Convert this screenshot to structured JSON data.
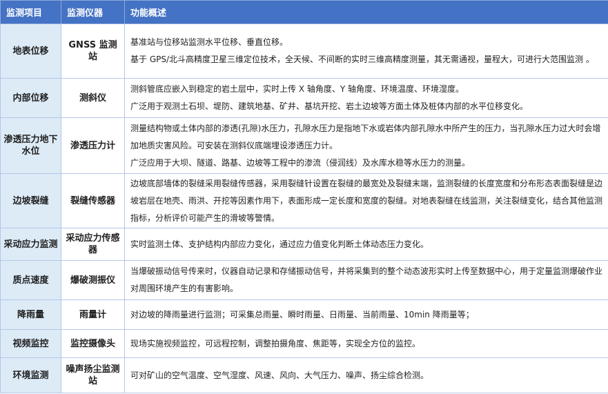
{
  "header": {
    "col1": "监测项目",
    "col2": "监测仪器",
    "col3": "功能概述"
  },
  "rows": [
    {
      "item": "地表位移",
      "instrument": "GNSS 监测站",
      "desc": [
        "基准站与位移站监测水平位移、垂直位移。",
        "基于 GPS/北斗高精度卫星三维定位技术，全天候、不间断的实时三维高精度测量，其无需通视，量程大，可进行大范围监测 。"
      ]
    },
    {
      "item": "内部位移",
      "instrument": "测斜仪",
      "desc": [
        "测斜管底应嵌入到稳定的岩土层中，实时上传 X 轴角度、Y 轴角度、环境温度、环境湿度。",
        "广泛用于观测土石坝、堤防、建筑地基、矿井、基坑开挖、岩土边坡等方面土体及桩体内部的水平位移变化。"
      ]
    },
    {
      "item": "渗透压力地下水位",
      "instrument": "渗透压力计",
      "desc": [
        "测量结构物或土体内部的渗透(孔隙)水压力，孔隙水压力是指地下水或岩体内部孔隙水中所产生的压力，当孔隙水压力过大时会增加地质灾害风险。可安装在测斜仪底端埋设渗透压力计。",
        "广泛应用于大坝、隧道、路基、边坡等工程中的渗流（侵润线）及水库水稳等水压力的测量。"
      ]
    },
    {
      "item": "边坡裂缝",
      "instrument": "裂缝传感器",
      "desc": [
        "边坡底部墙体的裂缝采用裂缝传感器，采用裂缝针设置在裂缝的最宽处及裂缝末端，监测裂缝的长度宽度和分布形态表面裂缝是边坡岩层在地壳、雨洪、开挖等因素作用下，表面形成一定长度和宽度的裂缝。对地表裂缝在线监测，关注裂缝变化，结合其他监测指标，分析评价可能产生的滑坡等警情。"
      ]
    },
    {
      "item": "采动应力监测",
      "instrument": "采动应力传感器",
      "desc": [
        "实时监测土体、支护结构内部应力变化，通过应力值变化判断土体动态压力变化。"
      ]
    },
    {
      "item": "质点速度",
      "instrument": "爆破测振仪",
      "desc": [
        "当爆破振动信号传来时，仪器自动记录和存储振动信号，并将采集到的整个动态波形实时上传至数据中心，用于定量监测爆破作业对周围环境产生的有害影响。"
      ]
    },
    {
      "item": "降雨量",
      "instrument": "雨量计",
      "desc": [
        "对边坡的降雨量进行监测；可采集总雨量、瞬时雨量、日雨量、当前雨量、10min 降雨量等；"
      ]
    },
    {
      "item": "视频监控",
      "instrument": "监控摄像头",
      "desc": [
        "现场实施视频监控，可远程控制，调整拍摄角度、焦距等，实现全方位的监控。"
      ]
    },
    {
      "item": "环境监测",
      "instrument": "噪声扬尘监测站",
      "desc": [
        "可对矿山的空气温度、空气湿度、风速、风向、大气压力、噪声、扬尘综合检测。"
      ]
    }
  ]
}
